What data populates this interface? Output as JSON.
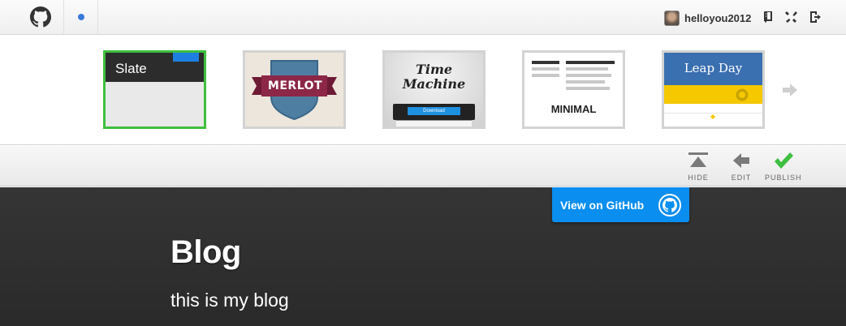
{
  "topbar": {
    "username": "helloyou2012",
    "icons": [
      "octocat-logo-icon",
      "notification-dot-icon",
      "avatar",
      "repo-icon",
      "settings-tools-icon",
      "sign-out-icon"
    ],
    "accent": "#3b7bd8"
  },
  "themes": {
    "items": [
      {
        "name": "slate",
        "label": "Slate",
        "selected": true
      },
      {
        "name": "merlot",
        "label": "MERLOT",
        "selected": false
      },
      {
        "name": "time-machine",
        "label_line1": "Time",
        "label_line2": "Machine",
        "button": "Download",
        "selected": false
      },
      {
        "name": "minimal",
        "label": "MINIMAL",
        "selected": false
      },
      {
        "name": "leap-day",
        "label": "Leap Day",
        "selected": false
      }
    ],
    "selected_color": "#3fbf3f"
  },
  "toolbar": {
    "hide_label": "HIDE",
    "edit_label": "EDIT",
    "publish_label": "PUBLISH",
    "publish_color": "#3fbf3f"
  },
  "preview": {
    "github_button": "View on GitHub",
    "title": "Blog",
    "subtitle": "this is my blog",
    "button_color": "#0a8ef0"
  }
}
